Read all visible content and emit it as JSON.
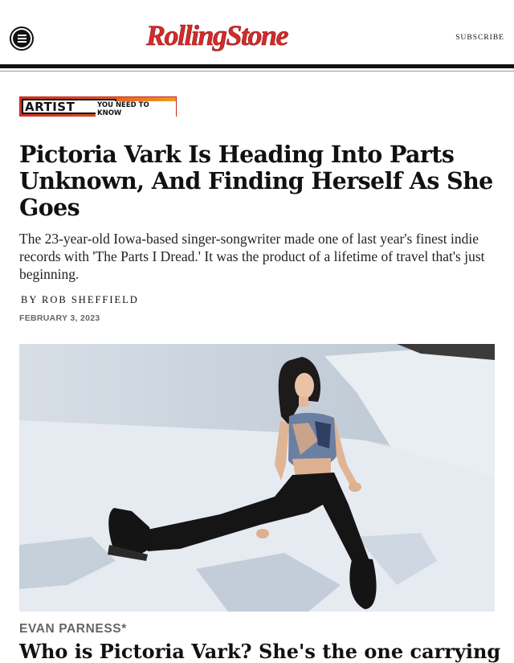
{
  "header": {
    "logo_text": "RollingStone",
    "subscribe_label": "SUBSCRIBE",
    "brand_color": "#d32b2b"
  },
  "badge": {
    "word": "ARTIST",
    "tag": "YOU NEED TO KNOW"
  },
  "article": {
    "headline": "Pictoria Vark Is Heading Into Parts Unknown, And Finding Herself As She Goes",
    "dek": "The 23-year-old Iowa-based singer-songwriter made one of last year's finest indie records with 'The Parts I Dread.' It was the product of a lifetime of travel that's just beginning.",
    "byline_prefix": "BY",
    "author": "ROB SHEFFIELD",
    "date": "FEBRUARY 3, 2023",
    "photo_credit": "EVAN PARNESS*",
    "caption_partial": "Who is Pictoria Vark? She's the one carrying"
  },
  "icons": {
    "menu": "hamburger-menu-icon"
  }
}
